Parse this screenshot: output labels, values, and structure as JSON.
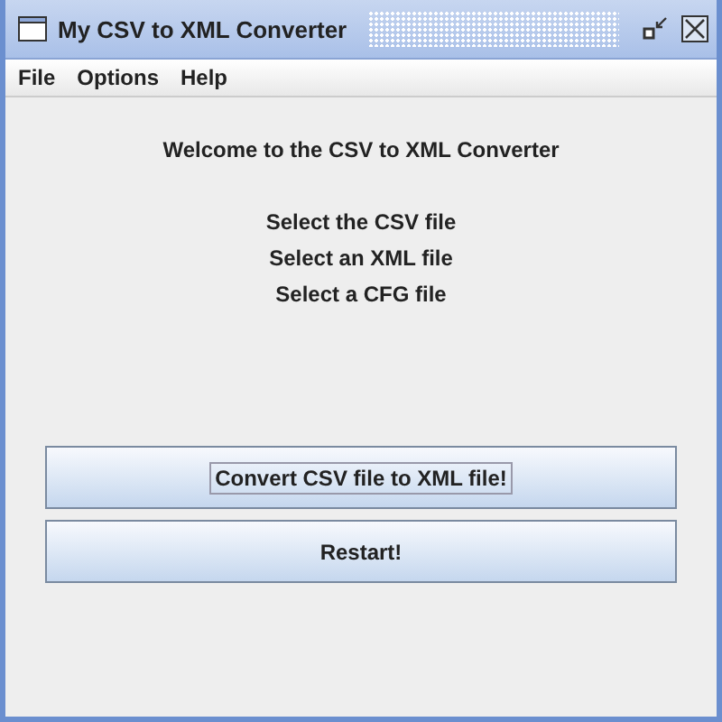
{
  "window": {
    "title": "My CSV to XML Converter"
  },
  "menu": [
    "File",
    "Options",
    "Help"
  ],
  "heading": "Welcome to the CSV to XML Converter",
  "links": [
    "Select the CSV file",
    "Select an XML file",
    "Select a CFG file"
  ],
  "buttons": [
    {
      "label": "Convert CSV file to XML file!",
      "focused": true
    },
    {
      "label": "Restart!",
      "focused": false
    }
  ]
}
